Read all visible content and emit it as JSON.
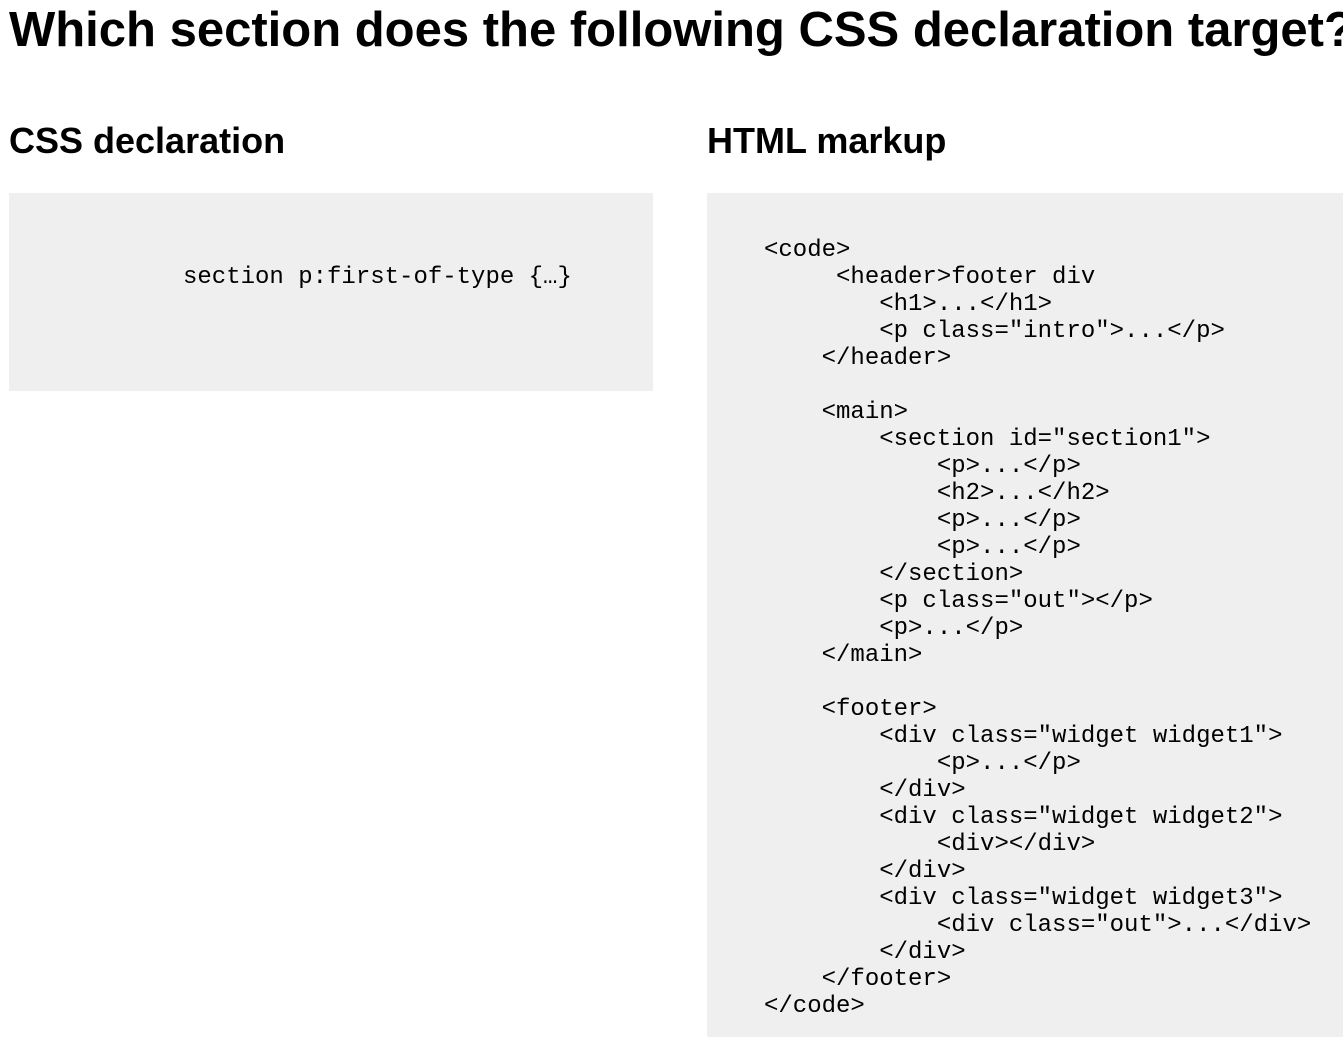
{
  "question": {
    "title": "Which section does the following CSS declaration target?"
  },
  "css_panel": {
    "heading": "CSS declaration",
    "declaration": "section p:first-of-type {…}"
  },
  "html_panel": {
    "heading": "HTML markup",
    "lines": [
      "<code>",
      "     <header>footer div",
      "        <h1>...</h1>",
      "        <p class=\"intro\">...</p>",
      "    </header>",
      "",
      "    <main>",
      "        <section id=\"section1\">",
      "            <p>...</p>",
      "            <h2>...</h2>",
      "            <p>...</p>",
      "            <p>...</p>",
      "        </section>",
      "        <p class=\"out\"></p>",
      "        <p>...</p>",
      "    </main>",
      "",
      "    <footer>",
      "        <div class=\"widget widget1\">",
      "            <p>...</p>",
      "        </div>",
      "        <div class=\"widget widget2\">",
      "            <div></div>",
      "        </div>",
      "        <div class=\"widget widget3\">",
      "            <div class=\"out\">...</div>",
      "        </div>",
      "    </footer>",
      "</code>"
    ]
  }
}
